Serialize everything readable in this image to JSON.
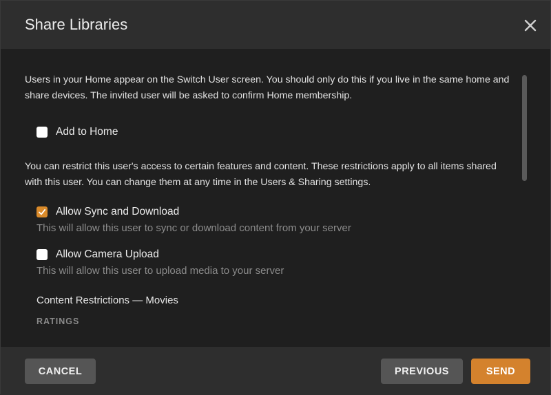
{
  "dialog": {
    "title": "Share Libraries",
    "close_icon": "close-icon"
  },
  "body": {
    "home_intro": "Users in your Home appear on the Switch User screen. You should only do this if you live in the same home and share devices. The invited user will be asked to confirm Home membership.",
    "add_to_home": {
      "label": "Add to Home",
      "checked": false
    },
    "restrict_intro": "You can restrict this user's access to certain features and content. These restrictions apply to all items shared with this user. You can change them at any time in the Users & Sharing settings.",
    "allow_sync": {
      "label": "Allow Sync and Download",
      "checked": true,
      "hint": "This will allow this user to sync or download content from your server"
    },
    "allow_camera": {
      "label": "Allow Camera Upload",
      "checked": false,
      "hint": "This will allow this user to upload media to your server"
    },
    "content_restrictions_title": "Content Restrictions — Movies",
    "ratings_label": "RATINGS"
  },
  "footer": {
    "cancel_label": "CANCEL",
    "previous_label": "PREVIOUS",
    "send_label": "SEND"
  },
  "colors": {
    "accent": "#d4822d",
    "checkbox_checked": "#d98a2a"
  }
}
